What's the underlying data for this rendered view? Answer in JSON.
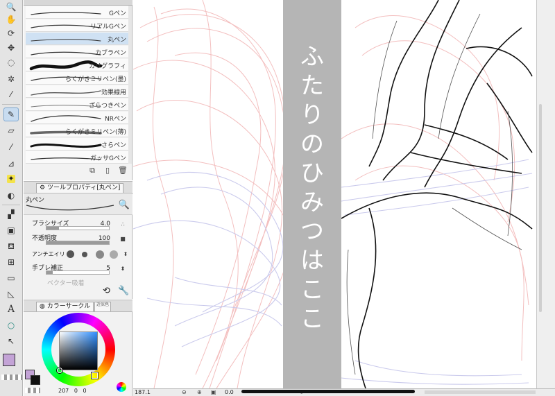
{
  "toolbar": {
    "tools": [
      {
        "icon": "zoom-icon",
        "glyph": "🔍"
      },
      {
        "icon": "hand-icon",
        "glyph": "✋"
      },
      {
        "icon": "rotate-icon",
        "glyph": "⟳"
      },
      {
        "icon": "move-layer-icon",
        "glyph": "✥"
      },
      {
        "icon": "lasso-icon",
        "glyph": "◌"
      },
      {
        "icon": "auto-select-icon",
        "glyph": "✲"
      },
      {
        "icon": "eyedropper-icon",
        "glyph": "⁄"
      },
      {
        "icon": "pen-icon",
        "glyph": "✎"
      },
      {
        "icon": "eraser-icon",
        "glyph": "▱"
      },
      {
        "icon": "brush-icon",
        "glyph": "⁄"
      },
      {
        "icon": "decoration-icon",
        "glyph": "⊿"
      },
      {
        "icon": "blend-icon",
        "glyph": "✦"
      },
      {
        "icon": "fill-icon",
        "glyph": "◐"
      },
      {
        "icon": "gradient-icon",
        "glyph": "▞"
      },
      {
        "icon": "gradient-fill-icon",
        "glyph": "▣"
      },
      {
        "icon": "bucket-icon",
        "glyph": "⛾"
      },
      {
        "icon": "frame-icon",
        "glyph": "⊞"
      },
      {
        "icon": "figure-icon",
        "glyph": "▭"
      },
      {
        "icon": "ruler-icon",
        "glyph": "◺"
      },
      {
        "icon": "text-icon",
        "glyph": "A"
      },
      {
        "icon": "balloon-icon",
        "glyph": "○"
      },
      {
        "icon": "object-select-icon",
        "glyph": "↖"
      }
    ]
  },
  "brushes": [
    {
      "label": "Gペン"
    },
    {
      "label": "リアルGペン"
    },
    {
      "label": "丸ペン"
    },
    {
      "label": "カブラペン"
    },
    {
      "label": "カリグラフィ"
    },
    {
      "label": "らくがきミリペン(墨)"
    },
    {
      "label": "効果線用"
    },
    {
      "label": "ざらつきペン"
    },
    {
      "label": "NRペン"
    },
    {
      "label": "らくがきミリペン(薄)"
    },
    {
      "label": "さらペン"
    },
    {
      "label": "ガッサGペン"
    }
  ],
  "properties": {
    "tab_label": "ツールプロパティ[丸ペン]",
    "preview_label": "丸ペン",
    "brush_size_label": "ブラシサイズ",
    "brush_size_value": "4.0",
    "opacity_label": "不透明度",
    "opacity_value": "100",
    "antialias_label": "アンチエイリ",
    "stabilization_label": "手ブレ補正",
    "stabilization_value": "5",
    "vector_label": "ベクター吸着"
  },
  "color_panel": {
    "tab_label": "カラーサークル",
    "tab2_label": "近似色",
    "h_value": "207",
    "s_value": "0",
    "v_value": "0",
    "fore_color": "#c3a3d6",
    "back_color": "#111111"
  },
  "canvas": {
    "title_chars": [
      "ふ",
      "た",
      "り",
      "の",
      "ひ",
      "み",
      "つ",
      "は",
      "こ",
      "こ"
    ]
  },
  "status": {
    "zoom": "187.1",
    "angle": "0.0"
  },
  "colors": {
    "sketch_pink": "#f2b8b8",
    "sketch_lavender": "#c8c8ec",
    "line_black": "#111111",
    "accent_blue": "#7ea7cf"
  }
}
